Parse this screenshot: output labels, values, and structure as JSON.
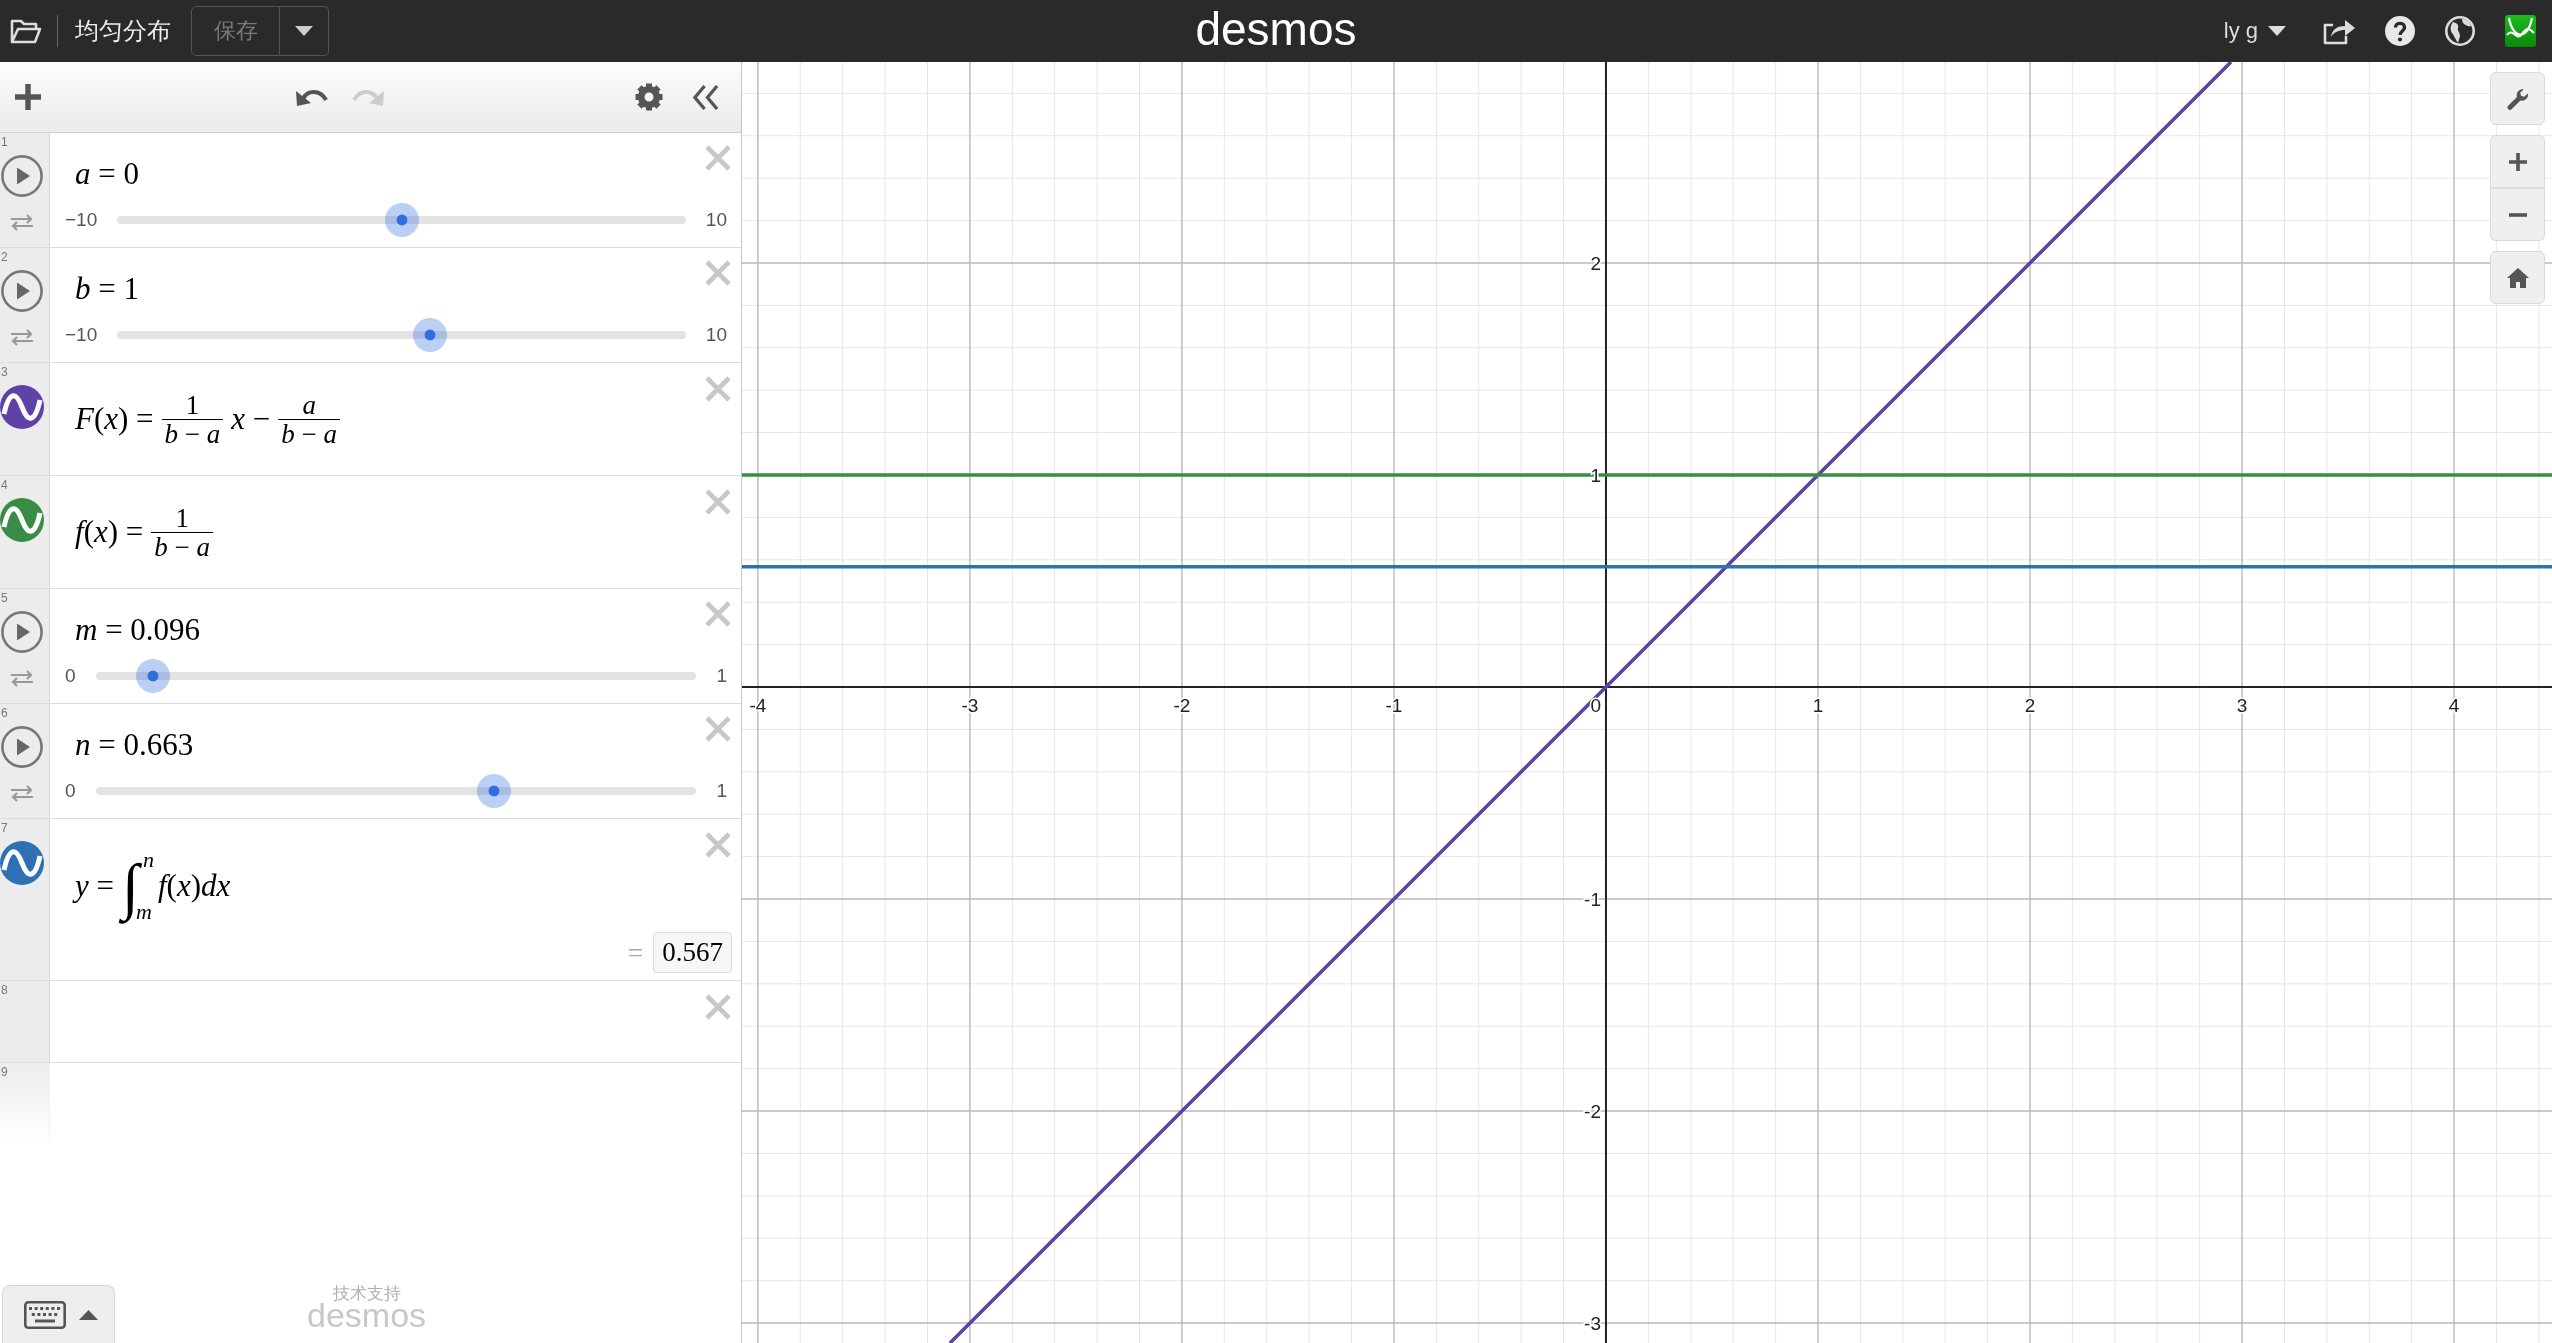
{
  "top_bar": {
    "title": "均匀分布",
    "save_button": {
      "label": "保存",
      "disabled": true
    },
    "logo": "desmos",
    "user": "ly g"
  },
  "expression_toolbar": {
    "undo": {
      "disabled": false
    },
    "redo": {
      "disabled": true
    }
  },
  "expressions": [
    {
      "number": "1",
      "kind": "slider",
      "equation": "*a* = 0",
      "min": "−10",
      "max": "10",
      "level": 0.5
    },
    {
      "number": "2",
      "kind": "slider",
      "equation": "*b* = 1",
      "min": "−10",
      "max": "10",
      "level": 0.55
    },
    {
      "number": "3",
      "kind": "function",
      "color": "#6042a6",
      "parts": [
        {
          "kind": "text",
          "text": "*F*(*x*) ="
        },
        {
          "kind": "fraction",
          "numerator": {
            "text": "1",
            "italic": false
          },
          "denominator": "*b* − *a*"
        },
        {
          "kind": "text",
          "text": "*x* −"
        },
        {
          "kind": "fraction",
          "numerator": {
            "text": "a",
            "italic": true
          },
          "denominator": "*b* − *a*"
        }
      ]
    },
    {
      "number": "4",
      "kind": "function",
      "color": "#388c46",
      "parts": [
        {
          "kind": "text",
          "text": "*f*(*x*) ="
        },
        {
          "kind": "fraction",
          "numerator": {
            "text": "1",
            "italic": false
          },
          "denominator": "*b* − *a*"
        }
      ]
    },
    {
      "number": "5",
      "kind": "slider",
      "equation": "*m* = 0.096",
      "min": "0",
      "max": "1",
      "level": 0.096
    },
    {
      "number": "6",
      "kind": "slider",
      "equation": "*n* = 0.663",
      "min": "0",
      "max": "1",
      "level": 0.663
    },
    {
      "number": "7",
      "kind": "function",
      "color": "#2d70b3",
      "parts": [
        {
          "kind": "text",
          "text": "*y* ="
        },
        {
          "kind": "integral",
          "sign": "∫",
          "upper": "n",
          "lower": "m"
        },
        {
          "kind": "text",
          "text": "*f*(*x*)*dx*"
        }
      ],
      "result": {
        "equals": "=",
        "value": "0.567"
      }
    },
    {
      "number": "8",
      "kind": "empty"
    },
    {
      "number": "9",
      "kind": "new"
    }
  ],
  "powered_by": {
    "caption": "技术支持",
    "logo": "desmos"
  },
  "graph": {
    "chart_data": {
      "type": "line",
      "x": [
        -4.075,
        -3.094,
        0,
        2.948,
        4.462
      ],
      "series": [
        {
          "color": "#6042a6",
          "values": [
            null,
            -3.094,
            0,
            2.948,
            null
          ]
        },
        {
          "color": "#388c46",
          "values": [
            1,
            1,
            1,
            1,
            1
          ]
        },
        {
          "color": "#2d70b3",
          "values": [
            0.567,
            0.567,
            0.567,
            0.567,
            0.567
          ]
        }
      ],
      "xlim": [
        -4.075,
        4.462
      ],
      "ylim": [
        -3.094,
        2.948
      ],
      "xticks": [
        -4,
        -3,
        -2,
        -1,
        0,
        1,
        2,
        3,
        4
      ],
      "yticks": [
        -3,
        -2,
        -1,
        1,
        2
      ],
      "grid": true
    }
  }
}
